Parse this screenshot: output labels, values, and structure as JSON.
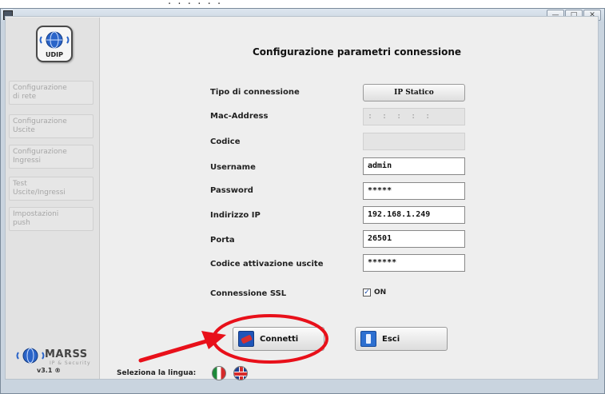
{
  "window": {
    "controls": {
      "minimize": "—",
      "maximize": "□",
      "close": "✕"
    }
  },
  "header": {
    "logo_text": "UDIP",
    "title": "Configurazione parametri connessione"
  },
  "sidebar": {
    "items": [
      {
        "line1": "Configurazione",
        "line2": "di rete"
      },
      {
        "line1": "Configurazione",
        "line2": "Uscite"
      },
      {
        "line1": "Configurazione",
        "line2": "Ingressi"
      },
      {
        "line1": "Test",
        "line2": "Uscite/Ingressi"
      },
      {
        "line1": "Impostazioni",
        "line2": "push"
      }
    ],
    "brand": {
      "name": "MARSS",
      "tagline": "IP & Security",
      "version": "v3.1 ®"
    }
  },
  "form": {
    "connection_type": {
      "label": "Tipo di connessione",
      "value": "IP Statico"
    },
    "mac_address": {
      "label": "Mac-Address",
      "value": ": : : : :"
    },
    "code": {
      "label": "Codice",
      "value": ""
    },
    "username": {
      "label": "Username",
      "value": "admin"
    },
    "password": {
      "label": "Password",
      "value": "*****"
    },
    "ip_address": {
      "label": "Indirizzo IP",
      "value": "192.168.1.249"
    },
    "port": {
      "label": "Porta",
      "value": "26501"
    },
    "activation_code": {
      "label": "Codice attivazione uscite",
      "value": "******"
    },
    "ssl": {
      "label": "Connessione SSL",
      "checked": true,
      "state_label": "ON"
    }
  },
  "actions": {
    "connect_label": "Connetti",
    "exit_label": "Esci"
  },
  "language": {
    "label": "Seleziona la lingua:",
    "options": [
      "italian-flag",
      "uk-flag"
    ]
  },
  "annotation": {
    "color": "#e8101a"
  }
}
